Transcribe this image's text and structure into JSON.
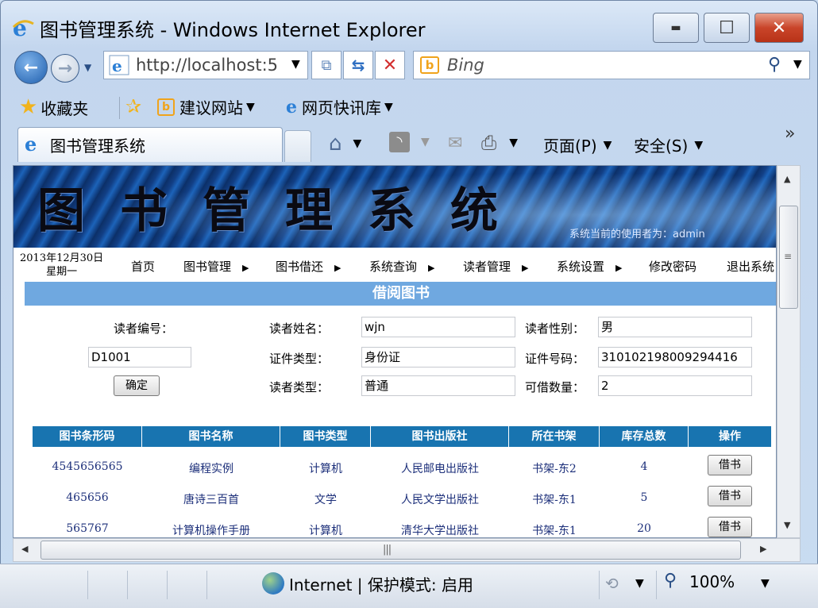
{
  "window": {
    "title": "图书管理系统 - Windows Internet Explorer",
    "minimize_glyph": "▬",
    "maximize_glyph": "☐",
    "close_glyph": "✕"
  },
  "browser": {
    "address": "http://localhost:5",
    "search_placeholder": "Bing",
    "favorites_label": "收藏夹",
    "fav_links": [
      "建议网站",
      "网页快讯库"
    ],
    "tab_title": "图书管理系统",
    "commands": [
      "页面(P)",
      "安全(S)"
    ],
    "more_glyph": "»"
  },
  "app": {
    "banner_title": "图书管理系统",
    "current_user_text": "系统当前的使用者为：admin",
    "date_line1": "2013年12月30日",
    "date_line2": "星期一",
    "menu": [
      {
        "label": "首页",
        "arrow": ""
      },
      {
        "label": "图书管理",
        "arrow": "▶"
      },
      {
        "label": "图书借还",
        "arrow": "▶"
      },
      {
        "label": "系统查询",
        "arrow": "▶"
      },
      {
        "label": "读者管理",
        "arrow": "▶"
      },
      {
        "label": "系统设置",
        "arrow": "▶"
      },
      {
        "label": "修改密码",
        "arrow": ""
      },
      {
        "label": "退出系统",
        "arrow": ""
      }
    ],
    "section_title": "借阅图书"
  },
  "form": {
    "reader_id_label": "读者编号：",
    "reader_id_value": "D1001",
    "confirm_label": "确定",
    "name_label": "读者姓名：",
    "name_value": "wjn",
    "gender_label": "读者性别：",
    "gender_value": "男",
    "cert_type_label": "证件类型：",
    "cert_type_value": "身份证",
    "cert_no_label": "证件号码：",
    "cert_no_value": "310102198009294416",
    "reader_type_label": "读者类型：",
    "reader_type_value": "普通",
    "quota_label": "可借数量：",
    "quota_value": "2"
  },
  "table": {
    "headers": [
      "图书条形码",
      "图书名称",
      "图书类型",
      "图书出版社",
      "所在书架",
      "库存总数",
      "操作"
    ],
    "rows": [
      {
        "barcode": "4545656565",
        "name": "编程实例",
        "type": "计算机",
        "publisher": "人民邮电出版社",
        "shelf": "书架-东2",
        "stock": "4",
        "action": "借书"
      },
      {
        "barcode": "465656",
        "name": "唐诗三百首",
        "type": "文学",
        "publisher": "人民文学出版社",
        "shelf": "书架-东1",
        "stock": "5",
        "action": "借书"
      },
      {
        "barcode": "565767",
        "name": "计算机操作手册",
        "type": "计算机",
        "publisher": "清华大学出版社",
        "shelf": "书架-东1",
        "stock": "20",
        "action": "借书"
      }
    ]
  },
  "status": {
    "zone_text": "Internet | 保护模式: 启用",
    "zoom": "100%"
  }
}
